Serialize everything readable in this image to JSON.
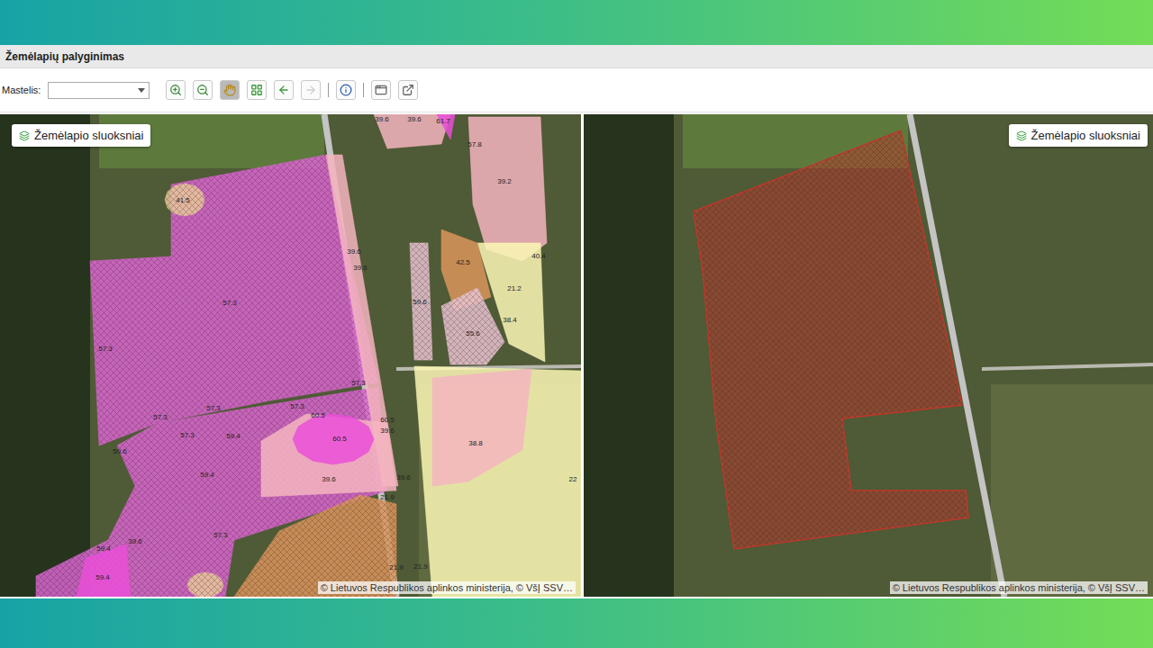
{
  "window": {
    "title": "Žemėlapių palyginimas"
  },
  "toolbar": {
    "scale_label": "Mastelis:",
    "scale_value": "",
    "tools": [
      {
        "kind": "zoomin",
        "selected": false,
        "disabled": false
      },
      {
        "kind": "zoomout",
        "selected": false,
        "disabled": false
      },
      {
        "kind": "pan",
        "selected": true,
        "disabled": false
      },
      {
        "kind": "extent",
        "selected": false,
        "disabled": false
      },
      {
        "kind": "back",
        "selected": false,
        "disabled": false
      },
      {
        "kind": "forward",
        "selected": false,
        "disabled": true
      },
      {
        "kind": "separator",
        "selected": false,
        "disabled": false
      },
      {
        "kind": "info",
        "selected": false,
        "disabled": false
      },
      {
        "kind": "separator",
        "selected": false,
        "disabled": false
      },
      {
        "kind": "window",
        "selected": false,
        "disabled": false
      },
      {
        "kind": "export",
        "selected": false,
        "disabled": false
      }
    ]
  },
  "panes": [
    {
      "layers_button": "Žemėlapio sluoksniai",
      "attribution": "© Lietuvos Respublikos aplinkos ministerija, © VšĮ SSV…",
      "zones": [
        {
          "color": "#d966d0",
          "hatched": true
        },
        {
          "color": "#d966d0",
          "hatched": true
        },
        {
          "color": "#f5b5c0",
          "hatched": false
        },
        {
          "color": "#f5b5c0",
          "hatched": false
        },
        {
          "color": "#ea4fd8",
          "hatched": false
        },
        {
          "color": "#d9955a",
          "hatched": true
        },
        {
          "color": "#ea4fd8",
          "hatched": false
        },
        {
          "color": "#e6c79a",
          "hatched": true
        },
        {
          "color": "#f5b5c0",
          "hatched": false
        },
        {
          "color": "#fbf7b5",
          "hatched": false
        },
        {
          "color": "#fbf7b5",
          "hatched": false
        },
        {
          "color": "#f5b5c0",
          "hatched": false
        },
        {
          "color": "#d9955a",
          "hatched": false
        },
        {
          "color": "#e8c4d0",
          "hatched": true
        },
        {
          "color": "#e8c4d0",
          "hatched": true
        },
        {
          "color": "#f5b5c0",
          "hatched": false
        },
        {
          "color": "#ea4fd8",
          "hatched": false
        },
        {
          "color": "#e6c79a",
          "hatched": true
        }
      ],
      "labels": [
        "41.5",
        "57.3",
        "39.6",
        "39.6",
        "57.3",
        "57.3",
        "57.3",
        "57.3",
        "57.3",
        "57.3",
        "60.5",
        "60.5",
        "60.5",
        "39.6",
        "59.4",
        "39.6",
        "59.4",
        "57.3",
        "59.6",
        "59.4",
        "59.4",
        "39.6",
        "21.9",
        "39.6",
        "38.8",
        "22",
        "39.2",
        "40.4",
        "21.2",
        "38.4",
        "42.5",
        "59.6",
        "55.6",
        "39.6",
        "39.6",
        "61.7",
        "57.8",
        "21.9",
        "21.9"
      ]
    },
    {
      "layers_button": "Žemėlapio sluoksniai",
      "attribution": "© Lietuvos Respublikos aplinkos ministerija, © VšĮ SSV…",
      "zones": [
        {
          "color": "#c0392b",
          "hatched": true
        }
      ],
      "labels": []
    }
  ]
}
